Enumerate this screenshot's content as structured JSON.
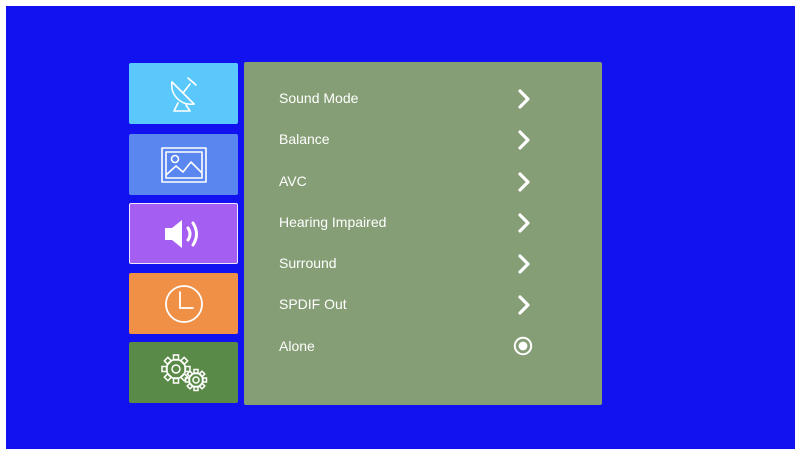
{
  "colors": {
    "background": "#1212f0",
    "panel": "#859e76",
    "tile_channel": "#5ac8fa",
    "tile_picture": "#5a86f0",
    "tile_sound": "#a45ef2",
    "tile_time": "#ef9046",
    "tile_setup": "#5a8a47",
    "text": "#ffffff"
  },
  "sidebar": {
    "selected_index": 2,
    "items": [
      {
        "icon": "satellite-dish-icon"
      },
      {
        "icon": "picture-icon"
      },
      {
        "icon": "speaker-icon"
      },
      {
        "icon": "clock-icon"
      },
      {
        "icon": "gears-icon"
      }
    ]
  },
  "menu": {
    "items": [
      {
        "label": "Sound Mode",
        "control": "chevron-right-icon"
      },
      {
        "label": "Balance",
        "control": "chevron-right-icon"
      },
      {
        "label": "AVC",
        "control": "chevron-right-icon"
      },
      {
        "label": "Hearing Impaired",
        "control": "chevron-right-icon"
      },
      {
        "label": "Surround",
        "control": "chevron-right-icon"
      },
      {
        "label": "SPDIF Out",
        "control": "chevron-right-icon"
      },
      {
        "label": "Alone",
        "control": "radio-selected-icon"
      }
    ]
  }
}
